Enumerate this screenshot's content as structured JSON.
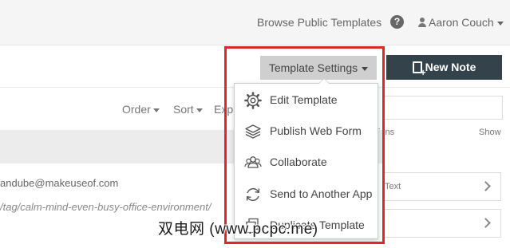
{
  "header": {
    "browse_public_templates": "Browse Public Templates",
    "help_icon_glyph": "?",
    "user_name": "Aaron Couch"
  },
  "toolbar": {
    "template_settings_label": "Template Settings",
    "new_note_label": "New Note"
  },
  "sortbar": {
    "order_label": "Order",
    "sort_label": "Sort",
    "export_label": "Exp"
  },
  "right_panel": {
    "sub_left": "ions",
    "sub_right": "Show",
    "card1_text": "Text"
  },
  "list": {
    "email_text": "andube@makeuseof.com",
    "url_text": "/tag/calm-mind-even-busy-office-environment/"
  },
  "template_menu": {
    "items": [
      {
        "label": "Edit Template",
        "icon": "gear-icon"
      },
      {
        "label": "Publish Web Form",
        "icon": "layers-icon"
      },
      {
        "label": "Collaborate",
        "icon": "users-icon"
      },
      {
        "label": "Send to Another App",
        "icon": "refresh-icon"
      },
      {
        "label": "Duplicate Template",
        "icon": "duplicate-icon"
      }
    ]
  },
  "watermark": "双电网 (www.pcpc.me)",
  "colors": {
    "new_note_bg": "#34424c",
    "highlight_border": "#e0262a",
    "template_settings_bg": "#cfcfcf"
  }
}
